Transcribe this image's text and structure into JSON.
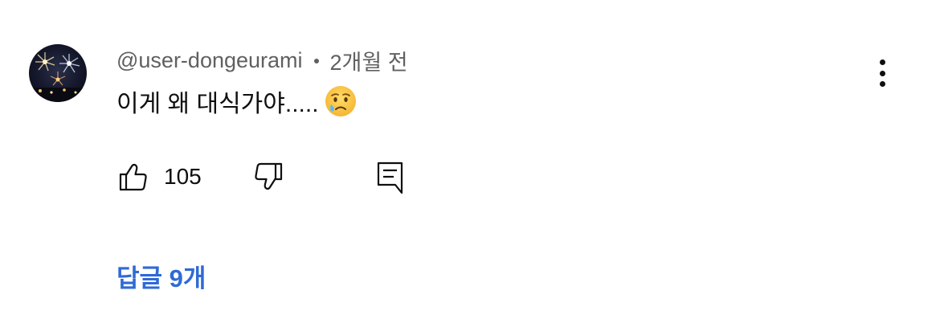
{
  "comment": {
    "author": "@user-dongeurami",
    "time": "2개월 전",
    "text": "이게 왜 대식가야.....",
    "emoji": "crying-face-emoji",
    "likes": "105",
    "replies_label": "답글 9개"
  },
  "colors": {
    "meta": "#606060",
    "text": "#0f0f0f",
    "link": "#2f6ad6",
    "background": "#ffffff"
  },
  "icons": {
    "like": "thumbs-up-icon",
    "dislike": "thumbs-down-icon",
    "reply": "comment-icon",
    "more": "more-vertical-icon"
  }
}
